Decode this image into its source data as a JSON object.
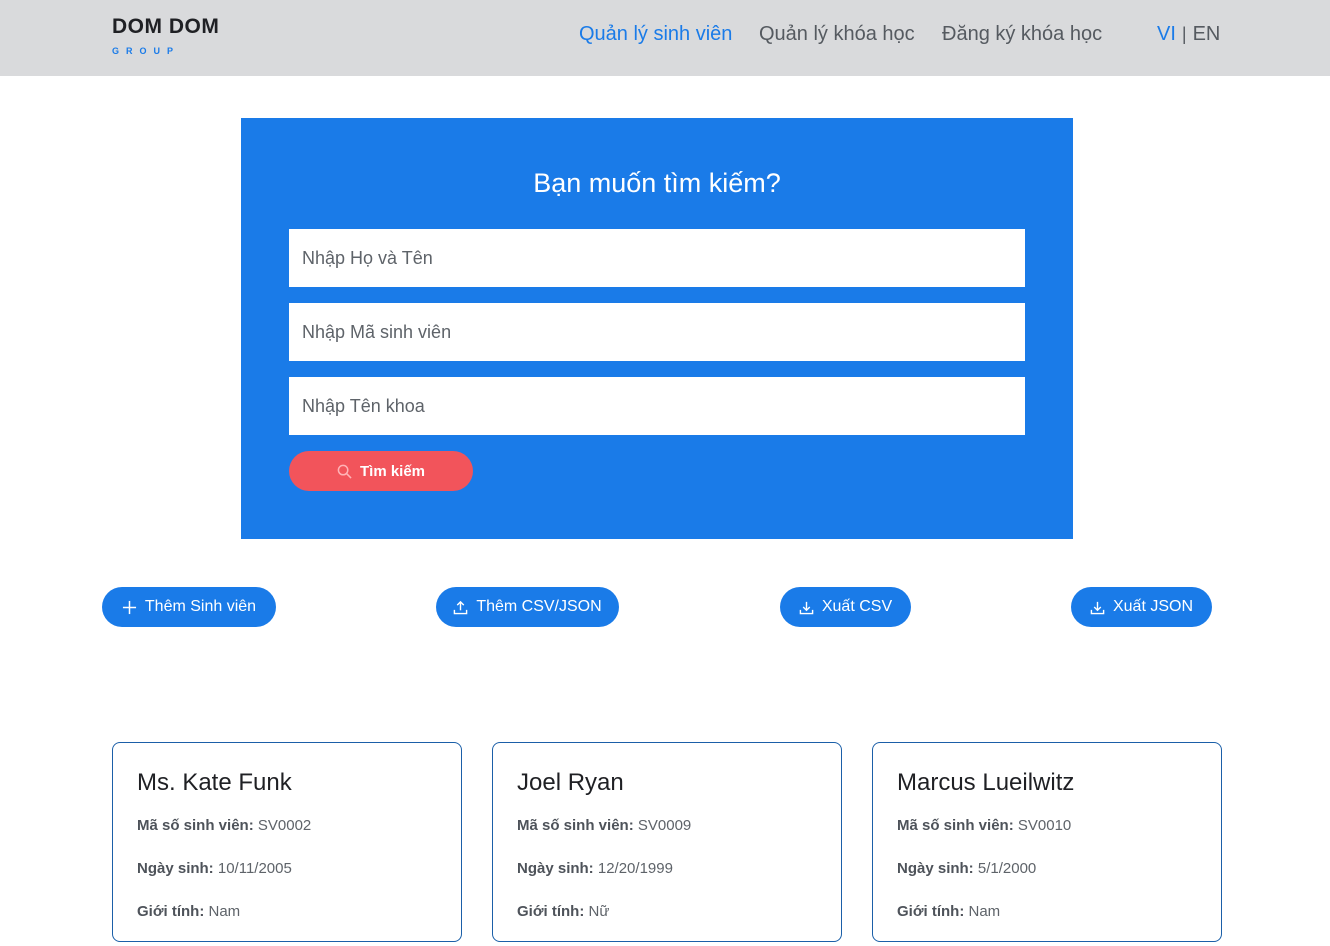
{
  "brand": {
    "name": "DOM DOM",
    "sub": "GROUP"
  },
  "nav": {
    "items": [
      {
        "label": "Quản lý sinh viên",
        "active": true
      },
      {
        "label": "Quản lý khóa học",
        "active": false
      },
      {
        "label": "Đăng ký khóa học",
        "active": false
      }
    ],
    "lang": {
      "vi": "VI",
      "sep": "|",
      "en": "EN"
    }
  },
  "search": {
    "title": "Bạn muốn tìm kiếm?",
    "name_placeholder": "Nhập Họ và Tên",
    "id_placeholder": "Nhập Mã sinh viên",
    "faculty_placeholder": "Nhập Tên khoa",
    "button_label": "Tìm kiếm",
    "button_icon": "search-icon"
  },
  "actions": {
    "add_student": {
      "label": "Thêm Sinh viên",
      "icon": "plus-icon"
    },
    "import": {
      "label": "Thêm CSV/JSON",
      "icon": "upload-icon"
    },
    "export_csv": {
      "label": "Xuất CSV",
      "icon": "download-icon"
    },
    "export_json": {
      "label": "Xuất JSON",
      "icon": "download-icon"
    }
  },
  "labels": {
    "id": "Mã số sinh viên:",
    "dob": "Ngày sinh:",
    "gender": "Giới tính:"
  },
  "students": [
    {
      "name": "Ms. Kate Funk",
      "id": "SV0002",
      "dob": "10/11/2005",
      "gender": "Nam"
    },
    {
      "name": "Joel Ryan",
      "id": "SV0009",
      "dob": "12/20/1999",
      "gender": "Nữ"
    },
    {
      "name": "Marcus Lueilwitz",
      "id": "SV0010",
      "dob": "5/1/2000",
      "gender": "Nam"
    }
  ],
  "colors": {
    "primary": "#1a7be8",
    "danger": "#f2545b",
    "navbar": "#d9dadc",
    "card_border": "#1b5fa8"
  }
}
